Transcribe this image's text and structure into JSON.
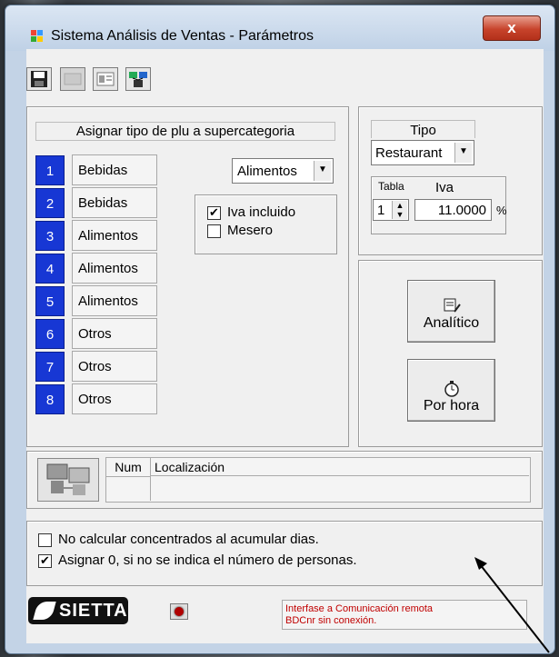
{
  "window": {
    "title": "Sistema Análisis de Ventas - Parámetros",
    "close_glyph": "x"
  },
  "toolbar": {
    "icons": [
      "save-icon",
      "disabled-icon",
      "form-icon",
      "network-icon"
    ]
  },
  "assign": {
    "header": "Asignar tipo de plu a supercategoria",
    "rows": [
      {
        "num": "1",
        "cat": "Bebidas"
      },
      {
        "num": "2",
        "cat": "Bebidas"
      },
      {
        "num": "3",
        "cat": "Alimentos"
      },
      {
        "num": "4",
        "cat": "Alimentos"
      },
      {
        "num": "5",
        "cat": "Alimentos"
      },
      {
        "num": "6",
        "cat": "Otros"
      },
      {
        "num": "7",
        "cat": "Otros"
      },
      {
        "num": "8",
        "cat": "Otros"
      }
    ],
    "category_select": "Alimentos",
    "iva_incluido": {
      "label": "Iva incluido",
      "checked": true
    },
    "mesero": {
      "label": "Mesero",
      "checked": false
    }
  },
  "tipo": {
    "label": "Tipo",
    "value": "Restaurant",
    "tabla_label": "Tabla",
    "iva_label": "Iva",
    "tabla_value": "1",
    "iva_value": "11.0000",
    "percent": "%"
  },
  "buttons": {
    "analitico": "Analítico",
    "por_hora": "Por hora"
  },
  "localizacion": {
    "col_num": "Num",
    "col_loc": "Localización"
  },
  "options": {
    "no_calcular": {
      "label": "No calcular concentrados al acumular dias.",
      "checked": false
    },
    "asignar_cero": {
      "label": "Asignar 0, si no se indica el número de personas.",
      "checked": true
    }
  },
  "footer": {
    "logo": "SIETTA",
    "status_line1": "Interfase a Comunicación remota",
    "status_line2": "BDCnr sin conexión."
  },
  "colors": {
    "accent": "#1737d4",
    "status_red": "#c00000",
    "close_red": "#c7432b"
  }
}
